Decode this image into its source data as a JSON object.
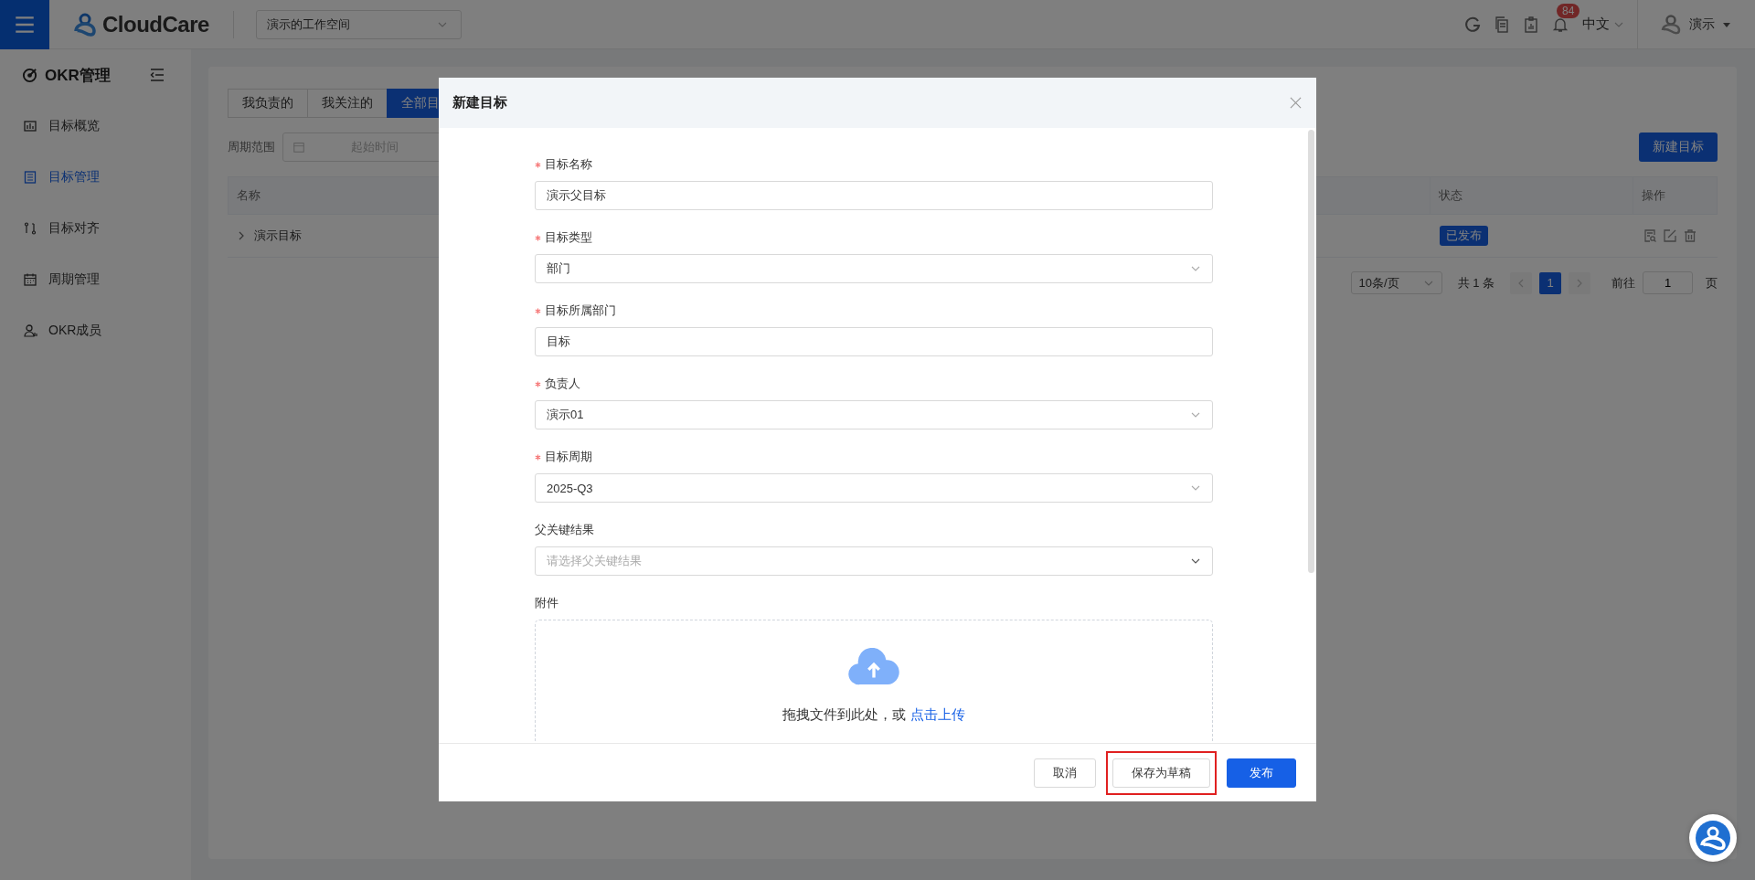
{
  "top_bar": {
    "brand": "CloudCare",
    "workspace": "演示的工作空间",
    "notification_count": "84",
    "language": "中文",
    "user": "演示"
  },
  "sidebar": {
    "title": "OKR管理",
    "items": [
      {
        "label": "目标概览",
        "selected": false
      },
      {
        "label": "目标管理",
        "selected": true
      },
      {
        "label": "目标对齐",
        "selected": false
      },
      {
        "label": "周期管理",
        "selected": false
      },
      {
        "label": "OKR成员",
        "selected": false
      }
    ]
  },
  "tabs": [
    {
      "label": "我负责的",
      "selected": false
    },
    {
      "label": "我关注的",
      "selected": false
    },
    {
      "label": "全部目",
      "selected": true
    }
  ],
  "filter": {
    "label": "周期范围",
    "placeholder": "起始时间"
  },
  "new_button": "新建目标",
  "table": {
    "columns": [
      "名称",
      "状态",
      "操作"
    ],
    "rows": [
      {
        "name": "演示目标",
        "expanded": false,
        "status": "已发布"
      }
    ]
  },
  "pagination": {
    "page_size": "10条/页",
    "total": "共 1 条",
    "pages": [
      {
        "label": "1",
        "selected": true
      }
    ],
    "goto_label": "前往",
    "goto_value": "1",
    "page_suffix": "页"
  },
  "dialog": {
    "title": "新建目标",
    "fields": [
      {
        "label": "目标名称",
        "required": true,
        "kind": "input",
        "value": "演示父目标"
      },
      {
        "label": "目标类型",
        "required": true,
        "kind": "select",
        "value": "部门"
      },
      {
        "label": "目标所属部门",
        "required": true,
        "kind": "input",
        "value": "目标"
      },
      {
        "label": "负责人",
        "required": true,
        "kind": "select",
        "value": "演示01"
      },
      {
        "label": "目标周期",
        "required": true,
        "kind": "select",
        "value": "2025-Q3"
      },
      {
        "label": "父关键结果",
        "required": false,
        "kind": "select",
        "placeholder": "请选择父关键结果"
      },
      {
        "label": "附件",
        "required": false,
        "kind": "upload",
        "upload_text": "拖拽文件到此处，或",
        "upload_link": "点击上传"
      }
    ],
    "buttons": [
      {
        "label": "取消",
        "kind": "default",
        "highlighted": false
      },
      {
        "label": "保存为草稿",
        "kind": "default",
        "highlighted": true
      },
      {
        "label": "发布",
        "kind": "primary",
        "highlighted": false
      }
    ]
  }
}
